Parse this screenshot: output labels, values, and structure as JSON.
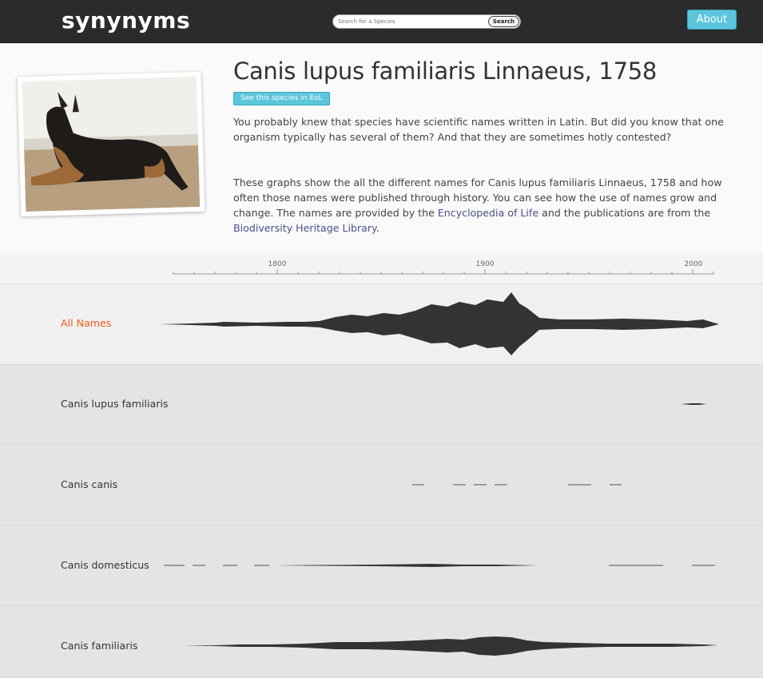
{
  "header": {
    "logo": "synynyms",
    "search_placeholder": "Search for a Species",
    "search_button": "Search",
    "about_button": "About"
  },
  "species": {
    "title": "Canis lupus familiaris Linnaeus, 1758",
    "eol_button": "See this species in EoL",
    "intro": "You probably knew that species have scientific names written in Latin. But did you know that one organism typically has several of them? And that they are sometimes hotly contested?",
    "desc_part1": "These graphs show the all the different names for Canis lupus familiaris Linnaeus, 1758 and how often those names were published through history. You can see how the use of names grow and change. The names are provided by the ",
    "eol_link": "Encyclopedia of Life",
    "desc_part2": " and the publications are from the ",
    "bhl_link": "Biodiversity Heritage Library",
    "desc_part3": "."
  },
  "timeline": {
    "ticks": [
      "1800",
      "1900",
      "2000"
    ]
  },
  "rows": [
    {
      "label": "All Names",
      "highlight": true
    },
    {
      "label": "Canis lupus familiaris"
    },
    {
      "label": "Canis canis"
    },
    {
      "label": "Canis domesticus"
    },
    {
      "label": "Canis familiaris"
    }
  ],
  "colors": {
    "accent": "#5bc5db",
    "highlight": "#ee5a1f",
    "stream": "#333333",
    "topbar": "#2b2b2b"
  }
}
